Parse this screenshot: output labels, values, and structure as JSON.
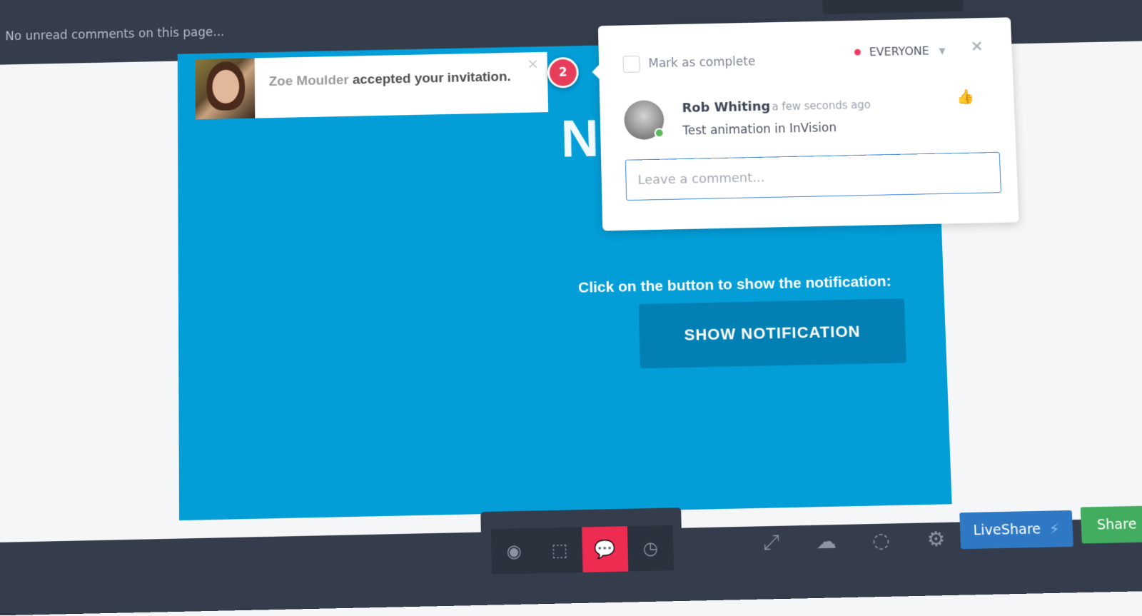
{
  "topbar": {
    "status_message": "No unread comments on this page..."
  },
  "canvas": {
    "heading_partial": "No",
    "prompt": "Click on the button to show the notification:",
    "button_label": "SHOW NOTIFICATION",
    "background_color": "#039dd8"
  },
  "toast": {
    "user_name": "Zoe Moulder",
    "message": "accepted your invitation.",
    "close_glyph": "×"
  },
  "marker": {
    "count": "2"
  },
  "comment_panel": {
    "mark_complete_label": "Mark as complete",
    "audience": "EVERYONE",
    "close_glyph": "×",
    "comment": {
      "author": "Rob Whiting",
      "time": "a few seconds ago",
      "text": "Test animation in InVision",
      "author_online": true
    },
    "input_placeholder": "Leave a comment..."
  },
  "toolbar": {
    "modes": [
      {
        "name": "preview-mode",
        "icon": "eye-icon",
        "glyph": "◉",
        "active": false
      },
      {
        "name": "build-mode",
        "icon": "select-cursor-icon",
        "glyph": "⬚",
        "active": false
      },
      {
        "name": "comment-mode",
        "icon": "speech-bubble-icon",
        "glyph": "💬",
        "active": true
      },
      {
        "name": "history-mode",
        "icon": "clock-icon",
        "glyph": "◷",
        "active": false
      }
    ],
    "tools": [
      {
        "name": "present-icon",
        "glyph": "⤢"
      },
      {
        "name": "cloud-sync-icon",
        "glyph": "☁"
      },
      {
        "name": "loading-circle-icon",
        "glyph": "◌"
      },
      {
        "name": "settings-gear-icon",
        "glyph": "⚙"
      }
    ],
    "liveshare_label": "LiveShare",
    "share_label": "Share"
  },
  "colors": {
    "accent_red": "#ee2b51",
    "liveshare_blue": "#2f79c4",
    "share_green": "#43ad5f",
    "dark_bar": "#353d4c"
  }
}
